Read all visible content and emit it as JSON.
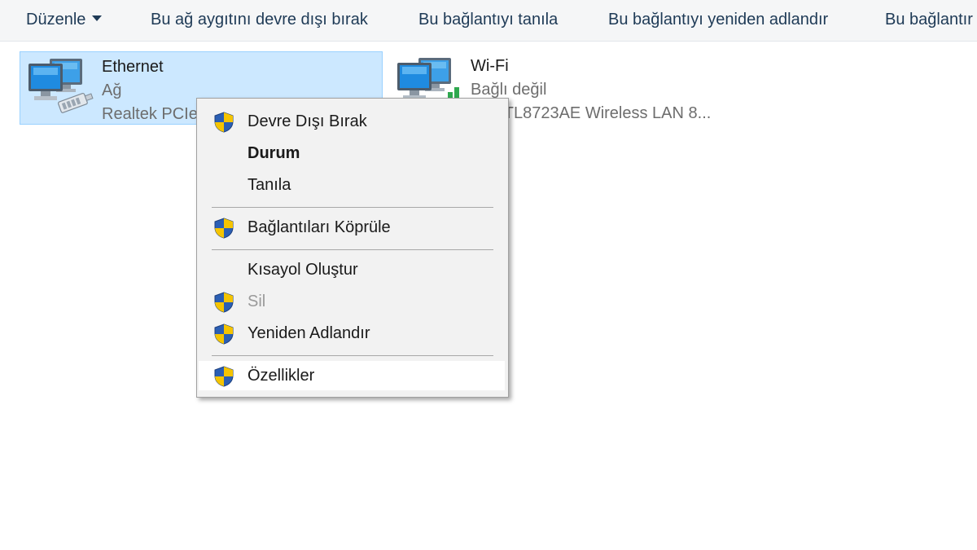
{
  "toolbar": {
    "items": [
      {
        "label": "Düzenle",
        "has_dropdown": true
      },
      {
        "label": "Bu ağ aygıtını devre dışı bırak"
      },
      {
        "label": "Bu bağlantıyı tanıla"
      },
      {
        "label": "Bu bağlantıyı yeniden adlandır"
      },
      {
        "label": "Bu bağlantır"
      }
    ]
  },
  "adapters": [
    {
      "name": "Ethernet",
      "status": "Ağ",
      "device": "Realtek PCIe",
      "selected": true,
      "icon": "ethernet-adapter-icon"
    },
    {
      "name": "Wi-Fi",
      "status": "Bağlı değil",
      "device": "ek RTL8723AE Wireless LAN 8...",
      "selected": false,
      "icon": "wifi-adapter-icon"
    }
  ],
  "context_menu": {
    "items": [
      {
        "label": "Devre Dışı Bırak",
        "shield": true
      },
      {
        "label": "Durum",
        "bold": true
      },
      {
        "label": "Tanıla"
      },
      {
        "label": "Bağlantıları Köprüle",
        "shield": true
      },
      {
        "label": "Kısayol Oluştur"
      },
      {
        "label": "Sil",
        "shield": true,
        "disabled": true
      },
      {
        "label": "Yeniden Adlandır",
        "shield": true
      },
      {
        "label": "Özellikler",
        "shield": true,
        "highlighted": true
      }
    ]
  },
  "colors": {
    "toolbar_text": "#1e3a56",
    "selection_bg": "#cce8ff",
    "selection_border": "#99d1ff",
    "menu_bg": "#f2f2f2",
    "shield_blue": "#2b5fb4",
    "shield_yellow": "#f5c400"
  }
}
